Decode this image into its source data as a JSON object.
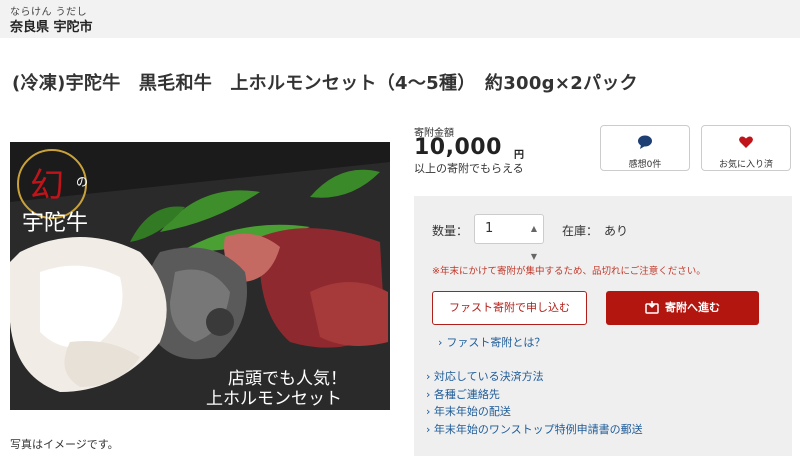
{
  "header": {
    "furigana": "ならけん うだし",
    "municipality": "奈良県 宇陀市"
  },
  "product": {
    "title": "(冷凍)宇陀牛　黒毛和牛　上ホルモンセット（4～5種）　約300g×2パック",
    "photo_overlay_lines": [
      "店頭でも人気！",
      "上ホルモンセット"
    ],
    "photo_logo_glyph": "幻",
    "photo_logo_small": "の",
    "photo_logo_text": "宇陀牛",
    "photo_caption": "写真はイメージです。"
  },
  "donation": {
    "amount_label": "寄附金額",
    "amount": "10,000",
    "unit": "円",
    "note": "以上の寄附でもらえる"
  },
  "actions": {
    "impressions_label": "感想0件",
    "impressions_icon": "speech-bubble-icon",
    "favorite_label": "お気に入り済",
    "favorite_icon": "heart-icon"
  },
  "order": {
    "quantity_label": "数量：",
    "quantity_value": "1",
    "stock_label": "在庫：",
    "stock_value": "あり",
    "notice": "※年末にかけて寄附が集中するため、品切れにご注意ください。",
    "fast_button": "ファスト寄附で申し込む",
    "donate_button": "寄附へ進む",
    "fast_link": "ファスト寄附とは？",
    "chevron": "›",
    "links": [
      "対応している決済方法",
      "各種ご連絡先",
      "年末年始の配送",
      "年末年始のワンストップ特例申請書の郵送"
    ]
  },
  "colors": {
    "accent_red": "#b3150f",
    "link_blue": "#1f5c99",
    "notice_red": "#c0392b",
    "heart_red": "#c0141b",
    "bubble_navy": "#1d3f73"
  }
}
